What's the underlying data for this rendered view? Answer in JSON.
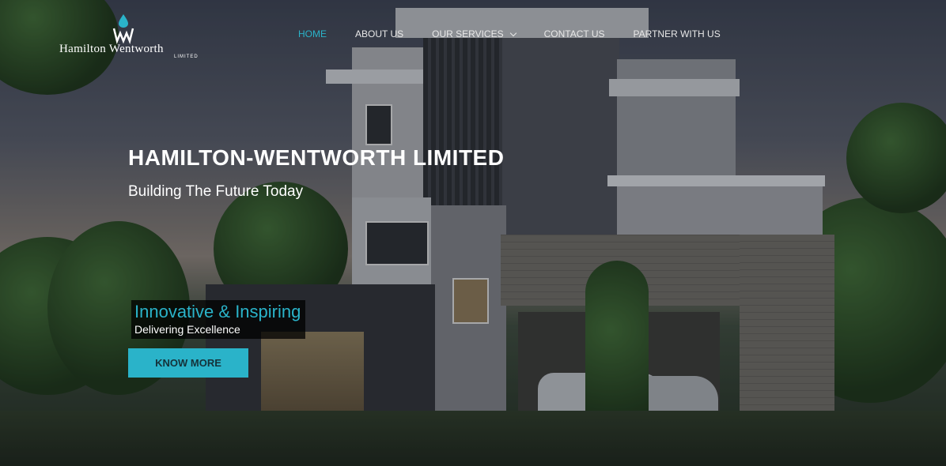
{
  "brand": {
    "name": "Hamilton Wentworth",
    "sub": "LIMITED"
  },
  "nav": {
    "items": [
      {
        "label": "HOME",
        "active": true
      },
      {
        "label": "ABOUT US"
      },
      {
        "label": "OUR SERVICES",
        "dropdown": true
      },
      {
        "label": "CONTACT US"
      },
      {
        "label": "PARTNER WITH US"
      }
    ]
  },
  "hero": {
    "title": "HAMILTON-WENTWORTH LIMITED",
    "subtitle": "Building The Future Today",
    "tagline": "Innovative & Inspiring",
    "tagline_sub": "Delivering Excellence",
    "cta": "KNOW MORE"
  },
  "colors": {
    "accent": "#2ab3c9",
    "text": "#ffffff"
  }
}
